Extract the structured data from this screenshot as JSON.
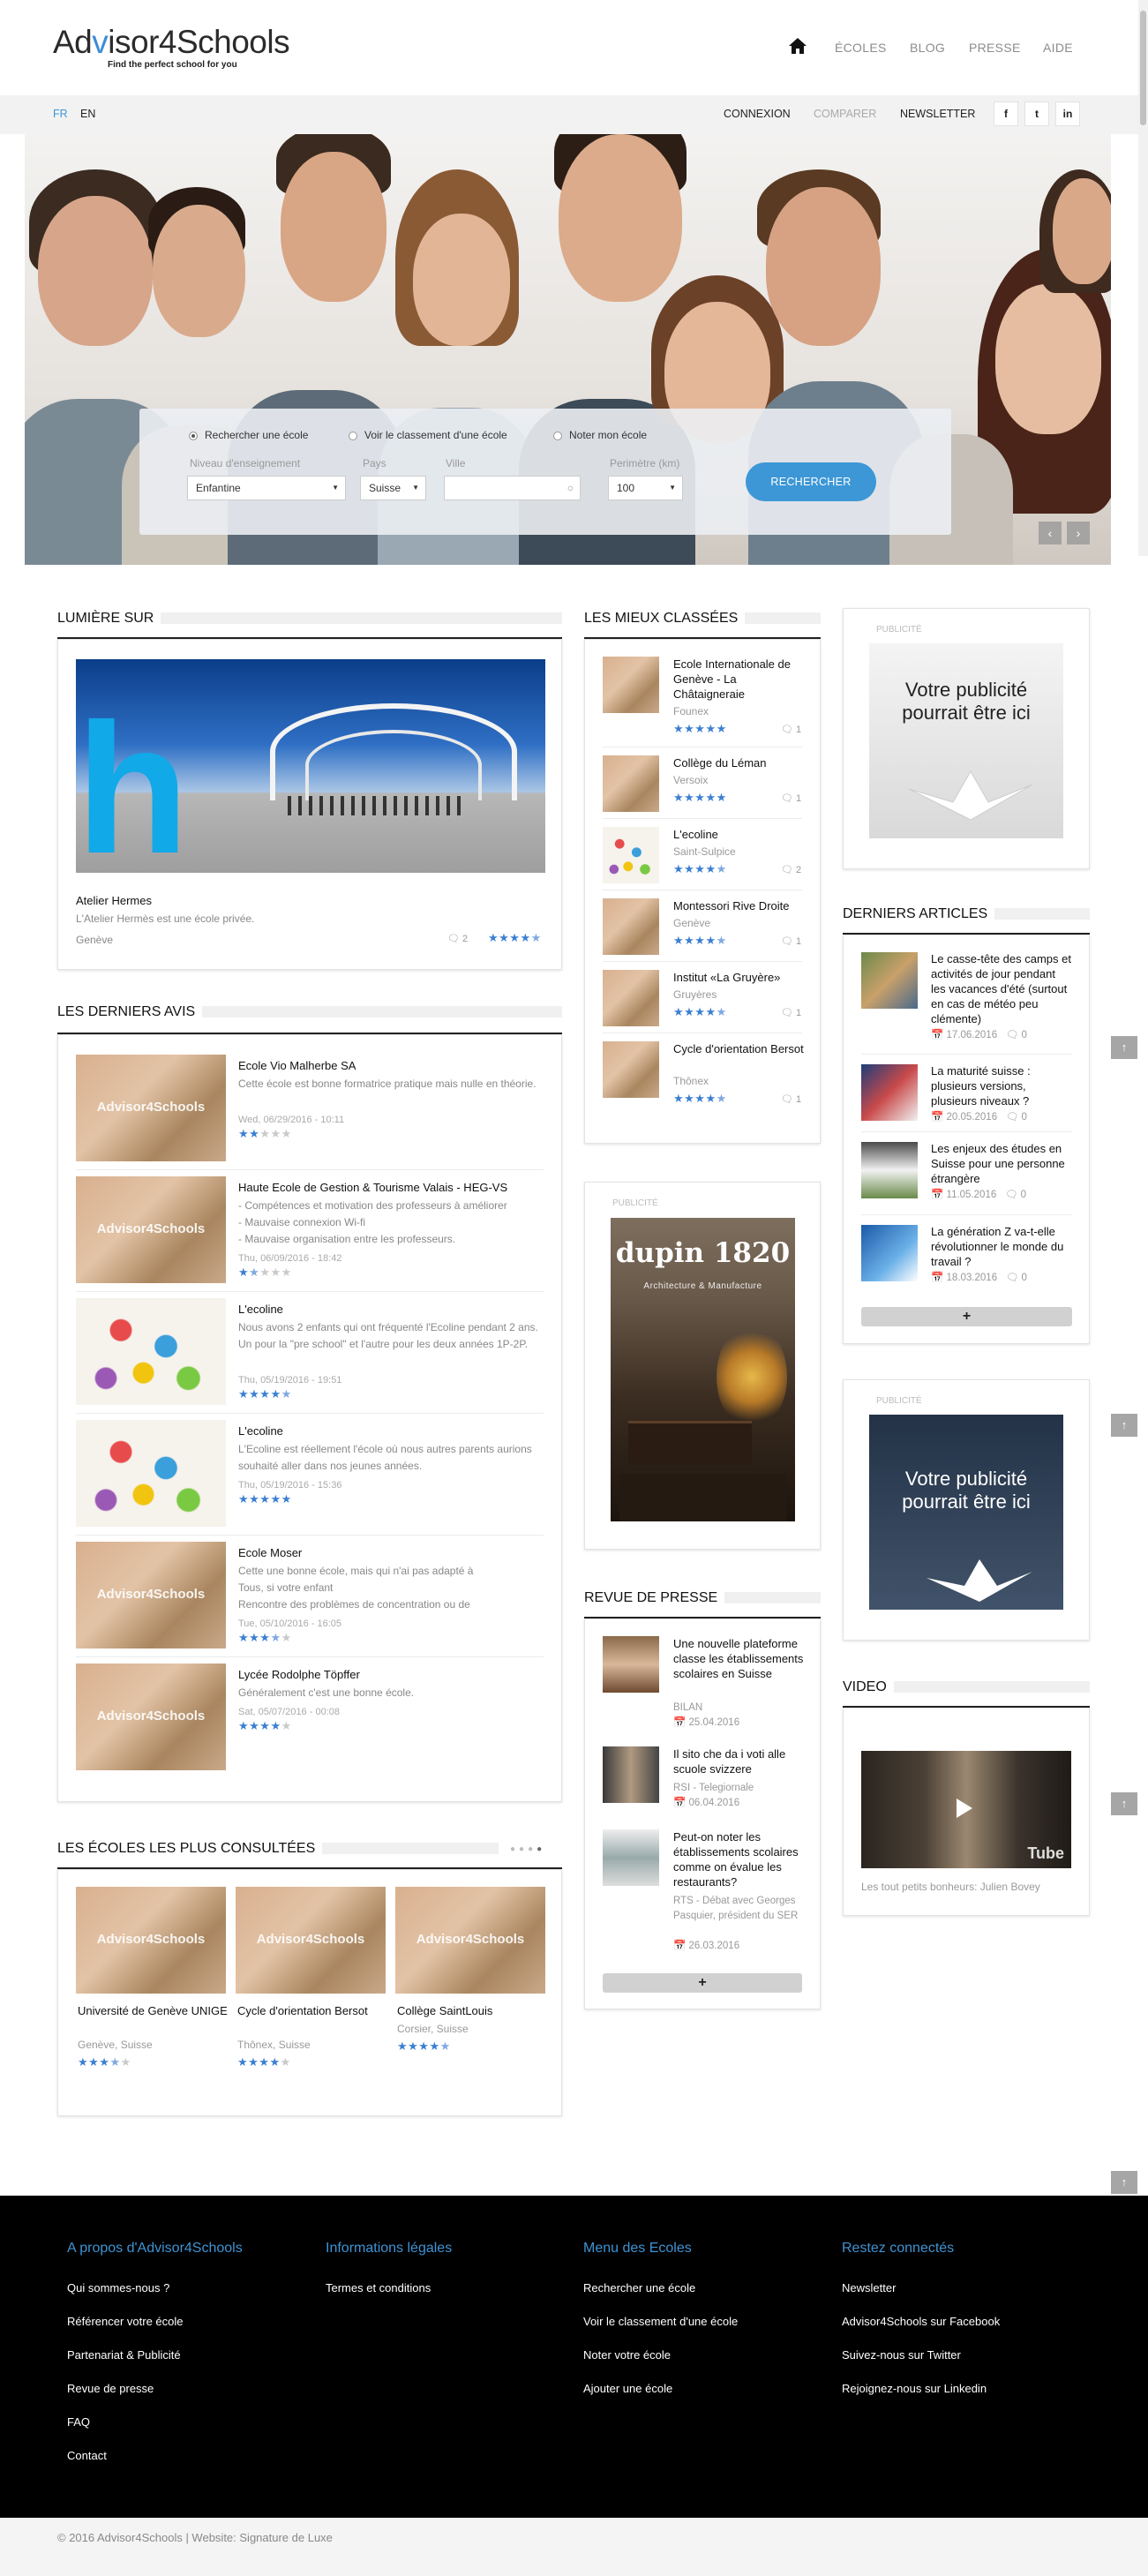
{
  "header": {
    "logo_text_pre": "Ad",
    "logo_text_v": "v",
    "logo_text_post": "isor4Schools",
    "logo_tagline": "Find the perfect school for you",
    "nav": [
      "ÉCOLES",
      "BLOG",
      "PRESSE",
      "AIDE"
    ],
    "home_icon": "home-icon"
  },
  "topbar": {
    "lang_fr": "FR",
    "lang_en": "EN",
    "connexion": "CONNEXION",
    "comparer": "COMPARER",
    "newsletter": "NEWSLETTER",
    "social": [
      "f",
      "t",
      "in"
    ]
  },
  "search": {
    "radio1": "Rechercher une école",
    "radio2": "Voir le classement d'une école",
    "radio3": "Noter mon école",
    "niveau_label": "Niveau d'enseignement",
    "niveau_value": "Enfantine",
    "pays_label": "Pays",
    "pays_value": "Suisse",
    "ville_label": "Ville",
    "ville_value": "",
    "perimetre_label": "Perimètre (km)",
    "perimetre_value": "100",
    "button": "RECHERCHER"
  },
  "lumiere": {
    "heading": "LUMIÈRE SUR",
    "title": "Atelier Hermes",
    "desc": "L'Atelier Hermès est une école privée.",
    "city": "Genève",
    "comments": "2",
    "rating": 4.5
  },
  "avis": {
    "heading": "LES DERNIERS AVIS",
    "items": [
      {
        "school": "Ecole Vio Malherbe SA",
        "lines": [
          "Cette école est bonne formatrice pratique mais nulle en théorie."
        ],
        "date": "Wed, 06/29/2016 - 10:11",
        "rating": 2,
        "thumb": "logo"
      },
      {
        "school": "Haute Ecole de Gestion & Tourisme Valais - HEG-VS",
        "lines": [
          "- Compétences et motivation des professeurs à améliorer",
          "- Mauvaise connexion Wi-fi",
          "- Mauvaise organisation entre les professeurs."
        ],
        "date": "Thu, 06/09/2016 - 18:42",
        "rating": 1.5,
        "thumb": "logo"
      },
      {
        "school": "L'ecoline",
        "lines": [
          "Nous avons 2 enfants qui ont fréquenté l'Ecoline pendant 2 ans. Un pour la \"pre school\" et l'autre pour les deux années 1P-2P."
        ],
        "date": "Thu, 05/19/2016 - 19:51",
        "rating": 4.5,
        "thumb": "paint"
      },
      {
        "school": "L'ecoline",
        "lines": [
          "L'Ecoline est réellement l'école où nous autres parents aurions souhaité aller dans nos jeunes années."
        ],
        "date": "Thu, 05/19/2016 - 15:36",
        "rating": 5,
        "thumb": "paint"
      },
      {
        "school": "Ecole Moser",
        "lines": [
          "Cette une bonne école, mais qui n'ai pas adapté à",
          "Tous, si votre enfant",
          "Rencontre des problèmes de concentration ou de"
        ],
        "date": "Tue, 05/10/2016 - 16:05",
        "rating": 3.5,
        "thumb": "logo"
      },
      {
        "school": "Lycée Rodolphe Töpffer",
        "lines": [
          "Généralement c'est une bonne école."
        ],
        "date": "Sat, 05/07/2016 - 00:08",
        "rating": 4,
        "thumb": "logo"
      }
    ]
  },
  "consultees": {
    "heading": "LES ÉCOLES LES PLUS CONSULTÉES",
    "items": [
      {
        "name": "Université de Genève UNIGE",
        "place": "Genève, Suisse",
        "rating": 3.5
      },
      {
        "name": "Cycle d'orientation Bersot",
        "place": "Thônex, Suisse",
        "rating": 4
      },
      {
        "name": "Collège SaintLouis",
        "place": "Corsier, Suisse",
        "rating": 4.5
      }
    ]
  },
  "classees": {
    "heading": "LES MIEUX CLASSÉES",
    "items": [
      {
        "name": "Ecole Internationale de Genève - La Châtaigneraie",
        "city": "Founex",
        "rating": 5,
        "comments": "1"
      },
      {
        "name": "Collège du Léman",
        "city": "Versoix",
        "rating": 5,
        "comments": "1"
      },
      {
        "name": "L'ecoline",
        "city": "Saint-Sulpice",
        "rating": 4.5,
        "comments": "2"
      },
      {
        "name": "Montessori Rive Droite",
        "city": "Genève",
        "rating": 4.5,
        "comments": "1"
      },
      {
        "name": "Institut «La Gruyère»",
        "city": "Gruyères",
        "rating": 4.5,
        "comments": "1"
      },
      {
        "name": "Cycle d'orientation Bersot",
        "city": "Thônex",
        "rating": 4.5,
        "comments": "1"
      }
    ]
  },
  "pub_dupin": {
    "label": "PUBLICITÉ",
    "brand": "dupin 1820",
    "sub": "Architecture & Manufacture"
  },
  "presse": {
    "heading": "REVUE DE PRESSE",
    "items": [
      {
        "title": "Une nouvelle plateforme classe les établissements scolaires en Suisse",
        "source": "BILAN",
        "date": "25.04.2016"
      },
      {
        "title": "Il sito che da i voti alle scuole svizzere",
        "source": "RSI - Telegiornale",
        "date": "06.04.2016"
      },
      {
        "title": "Peut-on noter les établissements scolaires comme on évalue les restaurants?",
        "source": "RTS - Débat avec Georges Pasquier, président du SER",
        "date": "26.03.2016"
      }
    ],
    "more": "+"
  },
  "pub1": {
    "label": "PUBLICITÉ",
    "text": "Votre publicité pourrait être ici"
  },
  "articles": {
    "heading": "DERNIERS ARTICLES",
    "items": [
      {
        "title": "Le casse-tête des camps et activités de jour pendant les vacances d'été (surtout en cas de météo peu clémente)",
        "date": "17.06.2016",
        "comments": "0"
      },
      {
        "title": "La maturité suisse : plusieurs versions, plusieurs niveaux ?",
        "date": "20.05.2016",
        "comments": "0"
      },
      {
        "title": "Les enjeux des études en Suisse pour une personne étrangère",
        "date": "11.05.2016",
        "comments": "0"
      },
      {
        "title": "La génération Z va-t-elle révolutionner le monde du travail ?",
        "date": "18.03.2016",
        "comments": "0"
      }
    ],
    "more": "+"
  },
  "pub2": {
    "label": "PUBLICITÉ",
    "text": "Votre publicité pourrait être ici"
  },
  "video": {
    "heading": "VIDEO",
    "caption": "Les tout petits bonheurs: Julien Bovey",
    "logo": "Tube"
  },
  "footer": {
    "cols": [
      {
        "heading": "A propos d'Advisor4Schools",
        "links": [
          "Qui sommes-nous ?",
          "Référencer votre école",
          "Partenariat & Publicité",
          "Revue de presse",
          "FAQ",
          "Contact"
        ]
      },
      {
        "heading": "Informations légales",
        "links": [
          "Termes et conditions"
        ]
      },
      {
        "heading": "Menu des Ecoles",
        "links": [
          "Rechercher une école",
          "Voir le classement d'une école",
          "Noter votre école",
          "Ajouter une école"
        ]
      },
      {
        "heading": "Restez connectés",
        "links": [
          "Newsletter",
          "Advisor4Schools sur Facebook",
          "Suivez-nous sur Twitter",
          "Rejoignez-nous sur Linkedin"
        ]
      }
    ],
    "copyright": "© 2016 Advisor4Schools | Website: Signature de Luxe"
  },
  "colors": {
    "accent": "#3d97d6",
    "star": "#3b7fd1",
    "footer_bg": "#000000",
    "footer_heading": "#3e93d4"
  }
}
